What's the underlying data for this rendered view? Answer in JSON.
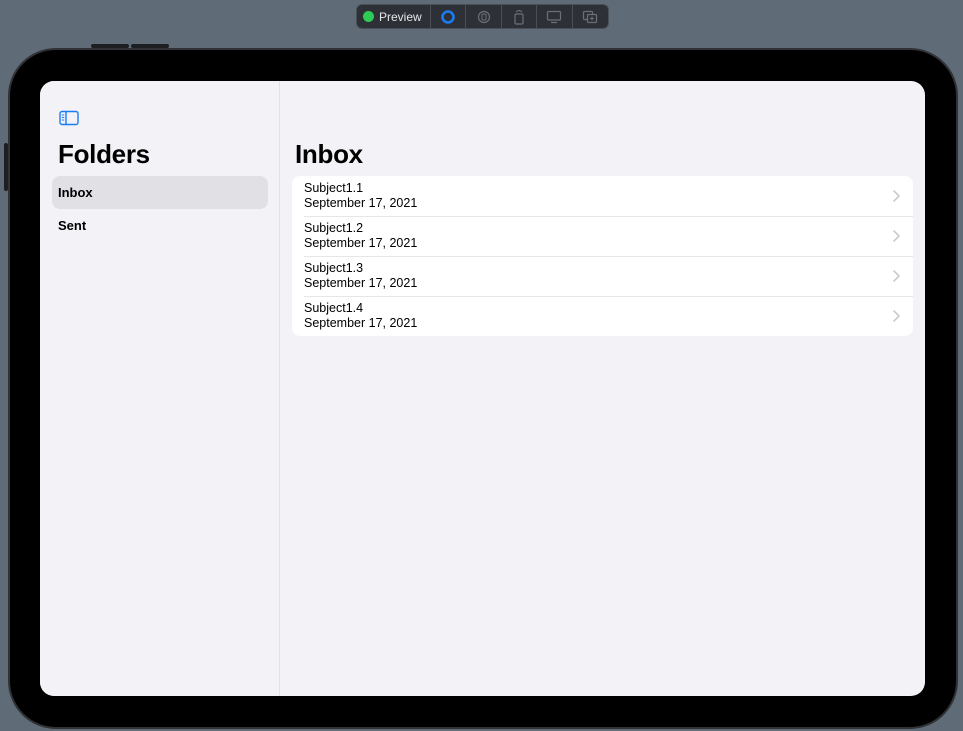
{
  "toolbar": {
    "live_label": "Preview",
    "live_color": "#2ecc55",
    "icons": [
      "live-preview-icon",
      "inspect-icon",
      "rotate-device-icon",
      "device-settings-icon",
      "duplicate-preview-icon"
    ]
  },
  "sidebar": {
    "toggle_icon": "sidebar-left-icon",
    "title": "Folders",
    "items": [
      {
        "label": "Inbox",
        "selected": true
      },
      {
        "label": "Sent",
        "selected": false
      }
    ]
  },
  "detail": {
    "title": "Inbox",
    "messages": [
      {
        "subject": "Subject1.1",
        "date": "September 17, 2021"
      },
      {
        "subject": "Subject1.2",
        "date": "September 17, 2021"
      },
      {
        "subject": "Subject1.3",
        "date": "September 17, 2021"
      },
      {
        "subject": "Subject1.4",
        "date": "September 17, 2021"
      }
    ]
  },
  "colors": {
    "accent": "#1a7cf5",
    "background": "#f2f2f7",
    "selection": "#e0e0e5",
    "chevron": "#c4c4c9"
  }
}
